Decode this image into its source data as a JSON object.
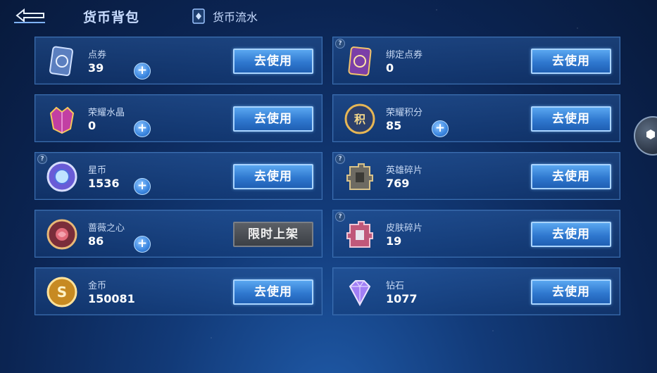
{
  "header": {
    "tab_active": "货币背包",
    "tab_flow": "货币流水",
    "back_icon": "back-arrow-icon",
    "flow_icon": "wallet-icon"
  },
  "colors": {
    "button_blue": "#2f78cf",
    "button_disabled": "#4a4e55",
    "card_border": "#3a6fb2"
  },
  "currencies": [
    {
      "name": "点券",
      "value": "39",
      "button": "去使用",
      "has_plus": true,
      "has_help": false,
      "icon": "coupon-card-icon"
    },
    {
      "name": "绑定点券",
      "value": "0",
      "button": "去使用",
      "has_plus": false,
      "has_help": true,
      "icon": "bound-coupon-card-icon"
    },
    {
      "name": "荣耀水晶",
      "value": "0",
      "button": "去使用",
      "has_plus": true,
      "has_help": false,
      "icon": "glory-crystal-icon"
    },
    {
      "name": "荣耀积分",
      "value": "85",
      "button": "去使用",
      "has_plus": true,
      "has_help": false,
      "icon": "glory-points-icon"
    },
    {
      "name": "星币",
      "value": "1536",
      "button": "去使用",
      "has_plus": true,
      "has_help": true,
      "icon": "star-coin-icon"
    },
    {
      "name": "英雄碎片",
      "value": "769",
      "button": "去使用",
      "has_plus": false,
      "has_help": true,
      "icon": "hero-fragment-icon"
    },
    {
      "name": "蔷薇之心",
      "value": "86",
      "button": "限时上架",
      "has_plus": true,
      "has_help": false,
      "icon": "rose-heart-icon"
    },
    {
      "name": "皮肤碎片",
      "value": "19",
      "button": "去使用",
      "has_plus": false,
      "has_help": true,
      "icon": "skin-fragment-icon"
    },
    {
      "name": "金币",
      "value": "150081",
      "button": "去使用",
      "has_plus": false,
      "has_help": false,
      "icon": "gold-coin-icon"
    },
    {
      "name": "钻石",
      "value": "1077",
      "button": "去使用",
      "has_plus": false,
      "has_help": false,
      "icon": "diamond-icon"
    }
  ],
  "help_mark": "?",
  "plus_mark": "+"
}
